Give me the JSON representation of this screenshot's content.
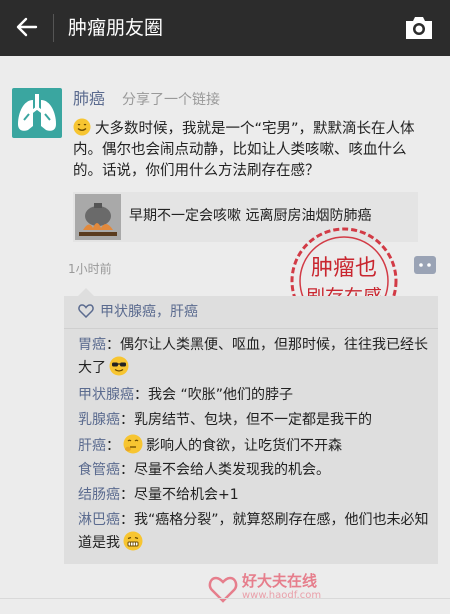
{
  "topbar": {
    "title": "肿瘤朋友圈"
  },
  "post": {
    "author": "肺癌",
    "shared_text": "分享了一个链接",
    "text": "大多数时候，我就是一个“宅男”，默默滴长在人体内。偶尔也会闹点动静，比如让人类咳嗽、咳血什么的。话说，你们用什么方法刷存在感？",
    "link_title": "早期不一定会咳嗽 远离厨房油烟防肺癌",
    "time": "1小时前",
    "stamp_line1": "肿瘤也",
    "stamp_line2": "刷存在感"
  },
  "likes": "甲状腺癌，肝癌",
  "comments": [
    {
      "who": "胃癌",
      "text": "：偶尔让人类黑便、呕血，但那时候，往往我已经长大了"
    },
    {
      "who": "甲状腺癌",
      "text": "：我会 “吹胀”他们的脖子"
    },
    {
      "who": "乳腺癌",
      "text": "：乳房结节、包块，但不一定都是我干的"
    },
    {
      "who": "肝癌",
      "text": "影响人的食欲，让吃货们不开森"
    },
    {
      "who": "食管癌",
      "text": "：尽量不会给人类发现我的机会。"
    },
    {
      "who": "结肠癌",
      "text": "：尽量不给机会+1"
    },
    {
      "who": "淋巴癌",
      "text": "：我“癌格分裂”，就算怒刷存在感，他们也未必知道是我"
    }
  ],
  "watermark": {
    "brand": "好大夫在线",
    "url": "www.haodf.com"
  },
  "icons": {
    "back": "arrow-left-icon",
    "camera": "camera-icon",
    "comment": "comment-icon",
    "heart": "heart-icon"
  }
}
